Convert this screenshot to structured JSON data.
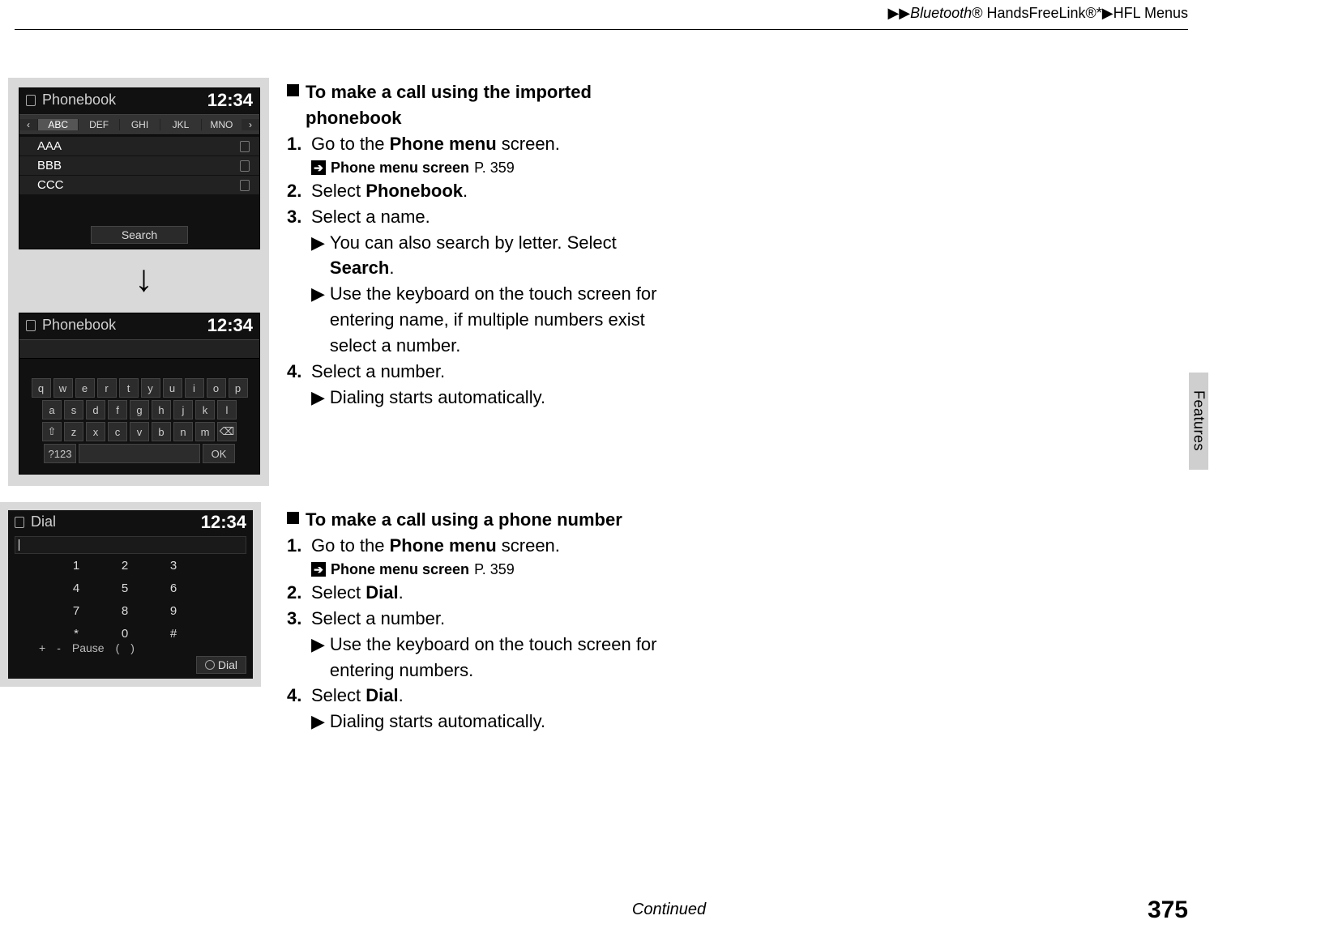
{
  "header": {
    "breadcrumb_pre": "▶▶",
    "breadcrumb_bt": "Bluetooth",
    "breadcrumb_rest": "® HandsFreeLink®*▶HFL Menus"
  },
  "side_tab": "Features",
  "footer_continued": "Continued",
  "page_number": "375",
  "screens": {
    "phonebook": {
      "title": "Phonebook",
      "time": "12:34",
      "nav_prev": "‹",
      "nav_next": "›",
      "tabs": [
        "ABC",
        "DEF",
        "GHI",
        "JKL",
        "MNO"
      ],
      "entries": [
        "AAA",
        "BBB",
        "CCC"
      ],
      "search_label": "Search"
    },
    "kbd": {
      "title": "Phonebook",
      "time": "12:34",
      "rows": [
        [
          "q",
          "w",
          "e",
          "r",
          "t",
          "y",
          "u",
          "i",
          "o",
          "p"
        ],
        [
          "a",
          "s",
          "d",
          "f",
          "g",
          "h",
          "j",
          "k",
          "l"
        ],
        [
          "⇧",
          "z",
          "x",
          "c",
          "v",
          "b",
          "n",
          "m",
          "⌫"
        ]
      ],
      "bottom_left": "?123",
      "bottom_right": "OK"
    },
    "dial": {
      "title": "Dial",
      "time": "12:34",
      "pad": [
        "1",
        "2",
        "3",
        "4",
        "5",
        "6",
        "7",
        "8",
        "9",
        "*",
        "0",
        "#"
      ],
      "bottom_row": [
        "+",
        "-",
        "Pause",
        "(",
        ")"
      ],
      "dial_label": "Dial"
    }
  },
  "section1": {
    "heading": "To make a call using the imported phonebook",
    "step1_pre": "Go to the ",
    "step1_b": "Phone menu",
    "step1_post": " screen.",
    "xref_label": "Phone menu screen",
    "xref_page": "P. 359",
    "step2_pre": "Select ",
    "step2_b": "Phonebook",
    "step2_post": ".",
    "step3": "Select a name.",
    "sub3a_pre": "You can also search by letter. Select ",
    "sub3a_b": "Search",
    "sub3a_post": ".",
    "sub3b": "Use the keyboard on the touch screen for entering name, if multiple numbers exist select a number.",
    "step4": "Select a number.",
    "sub4": "Dialing starts automatically."
  },
  "section2": {
    "heading": "To make a call using a phone number",
    "step1_pre": "Go to the ",
    "step1_b": "Phone menu",
    "step1_post": " screen.",
    "xref_label": "Phone menu screen",
    "xref_page": "P. 359",
    "step2_pre": "Select ",
    "step2_b": "Dial",
    "step2_post": ".",
    "step3": "Select a number.",
    "sub3": "Use the keyboard on the touch screen for entering numbers.",
    "step4_pre": "Select ",
    "step4_b": "Dial",
    "step4_post": ".",
    "sub4": "Dialing starts automatically."
  }
}
